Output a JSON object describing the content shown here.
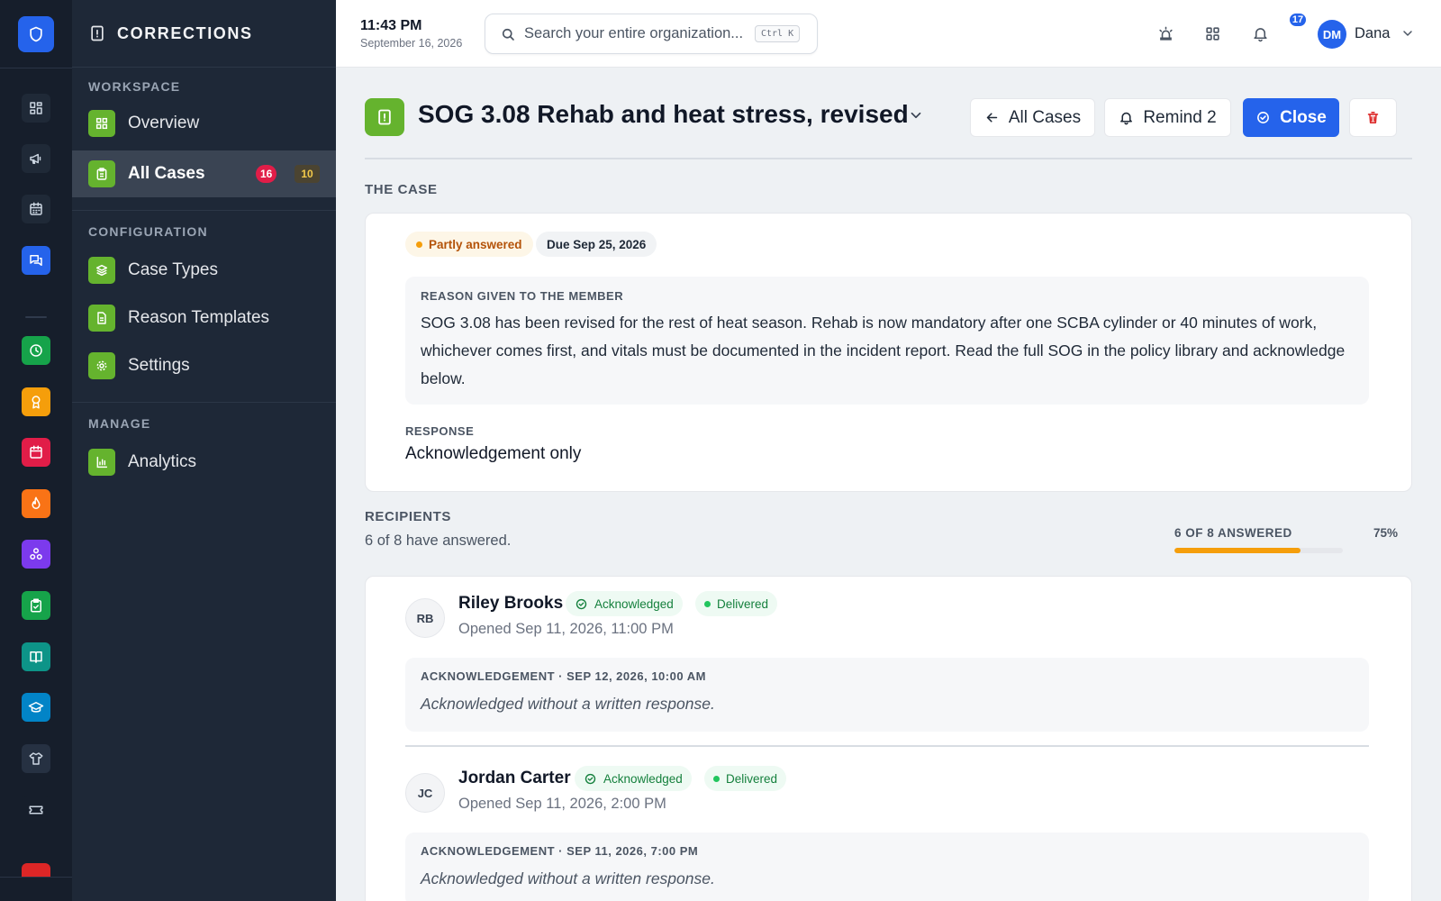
{
  "app": {
    "title": "CORRECTIONS"
  },
  "rail": {
    "items": [
      {
        "icon": "dashboard-icon",
        "color": "#1f2937"
      },
      {
        "icon": "megaphone-icon",
        "color": "#1f2937"
      },
      {
        "icon": "calendar-icon",
        "color": "#1f2937"
      },
      {
        "icon": "chat-icon",
        "color": "#2563eb"
      },
      {
        "icon": "clock-icon",
        "color": "#16a34a"
      },
      {
        "icon": "award-icon",
        "color": "#f59e0b"
      },
      {
        "icon": "calendar-event-icon",
        "color": "#e11d48"
      },
      {
        "icon": "flame-icon",
        "color": "#f97316"
      },
      {
        "icon": "network-icon",
        "color": "#7c3aed"
      },
      {
        "icon": "clipboard-check-icon",
        "color": "#16a34a"
      },
      {
        "icon": "book-icon",
        "color": "#0d9488"
      },
      {
        "icon": "graduation-cap-icon",
        "color": "#0284c7"
      },
      {
        "icon": "shirt-icon",
        "color": "#1f2937"
      },
      {
        "icon": "ticket-icon",
        "color": "#161e2b"
      }
    ]
  },
  "sidebar": {
    "workspace_label": "WORKSPACE",
    "configuration_label": "CONFIGURATION",
    "manage_label": "MANAGE",
    "overview": "Overview",
    "all_cases": "All Cases",
    "all_cases_badge_red": "16",
    "all_cases_badge_amber": "10",
    "case_types": "Case Types",
    "reason_templates": "Reason Templates",
    "settings": "Settings",
    "analytics": "Analytics"
  },
  "topbar": {
    "time": "11:43 PM",
    "date": "September 16, 2026",
    "search_placeholder": "Search your entire organization...",
    "search_shortcut": "Ctrl K",
    "notifications_count": "17",
    "user_initials": "DM",
    "user_name": "Dana"
  },
  "case": {
    "title": "SOG 3.08 Rehab and heat stress, revised",
    "btn_all_cases": "All Cases",
    "btn_remind": "Remind 2",
    "btn_close": "Close",
    "section_label": "THE CASE",
    "status": "Partly answered",
    "due": "Due Sep 25, 2026",
    "reason_label": "REASON GIVEN TO THE MEMBER",
    "reason_text": "SOG 3.08 has been revised for the rest of heat season. Rehab is now mandatory after one SCBA cylinder or 40 minutes of work, whichever comes first, and vitals must be documented in the incident report. Read the full SOG in the policy library and acknowledge below.",
    "response_label": "RESPONSE",
    "response_value": "Acknowledgement only"
  },
  "recipients": {
    "section_label": "RECIPIENTS",
    "summary": "6 of 8 have answered.",
    "progress_label": "6 OF 8 ANSWERED",
    "progress_pct": "75%",
    "progress_fraction": 0.75,
    "list": [
      {
        "initials": "RB",
        "name": "Riley Brooks",
        "status": "Acknowledged",
        "delivery": "Delivered",
        "opened": "Opened Sep 11, 2026, 11:00 PM",
        "ack_label": "ACKNOWLEDGEMENT · SEP 12, 2026, 10:00 AM",
        "ack_text": "Acknowledged without a written response."
      },
      {
        "initials": "JC",
        "name": "Jordan Carter",
        "status": "Acknowledged",
        "delivery": "Delivered",
        "opened": "Opened Sep 11, 2026, 2:00 PM",
        "ack_label": "ACKNOWLEDGEMENT · SEP 11, 2026, 7:00 PM",
        "ack_text": "Acknowledged without a written response."
      }
    ]
  },
  "colors": {
    "accent": "#2563eb",
    "module_green": "#65b32e",
    "progress": "#f59e0b",
    "danger": "#dc2626",
    "success": "#15803d"
  }
}
